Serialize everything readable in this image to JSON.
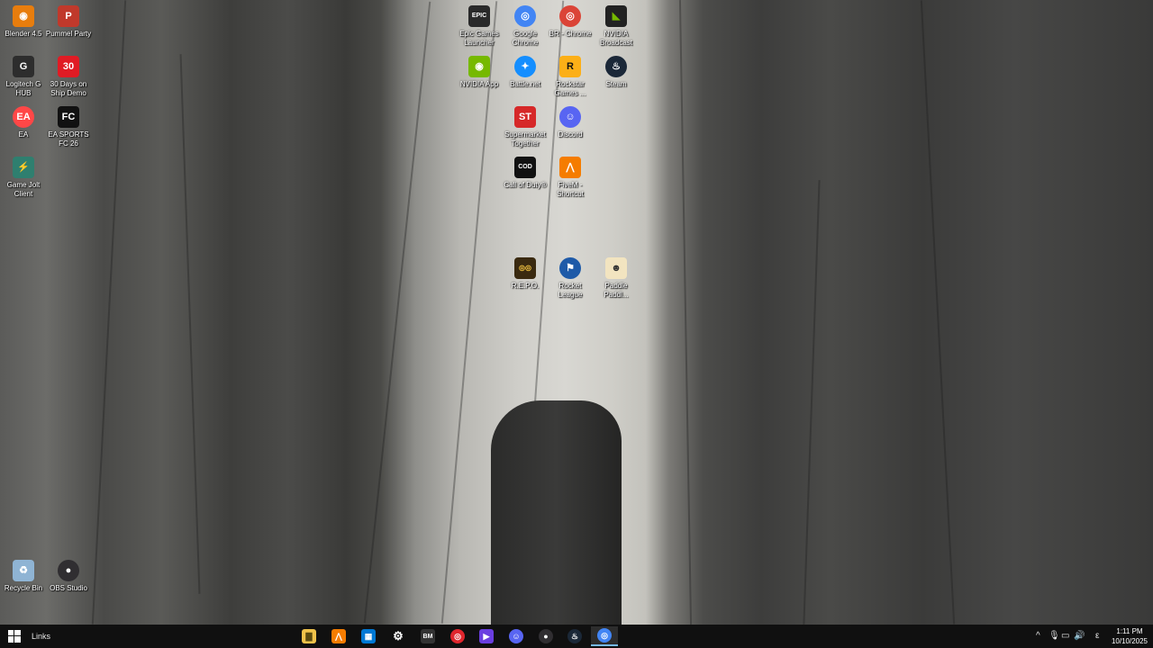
{
  "desktop": {
    "icons": [
      {
        "label": "Blender 4.5",
        "icon": "blender-icon",
        "color": "#e87d0d",
        "glyph": "◉"
      },
      {
        "label": "Pummel Party",
        "icon": "pummel-party-icon",
        "color": "#c0392b",
        "glyph": "P"
      },
      {
        "label": "Logitech G HUB",
        "icon": "logitech-ghub-icon",
        "color": "#2d2d2d",
        "glyph": "G"
      },
      {
        "label": "30 Days on Ship Demo",
        "icon": "30-days-on-ship-icon",
        "color": "#e01b24",
        "glyph": "30"
      },
      {
        "label": "EA",
        "icon": "ea-icon",
        "color": "#ff4747",
        "glyph": "EA"
      },
      {
        "label": "EA SPORTS FC 26",
        "icon": "ea-sports-fc-icon",
        "color": "#111111",
        "glyph": "FC"
      },
      {
        "label": "Game Jolt Client",
        "icon": "game-jolt-icon",
        "color": "#2f7f6f",
        "glyph": "⚡"
      },
      {
        "label": "Epic Games Launcher",
        "icon": "epic-games-icon",
        "color": "#2a2a2a",
        "glyph": "EPIC"
      },
      {
        "label": "Google Chrome",
        "icon": "chrome-icon",
        "color": "#4285f4",
        "glyph": "◎"
      },
      {
        "label": "BR - Chrome",
        "icon": "chrome-profile-icon",
        "color": "#db4437",
        "glyph": "◎"
      },
      {
        "label": "NVIDIA Broadcast",
        "icon": "nvidia-broadcast-icon",
        "color": "#222222",
        "glyph": "◣"
      },
      {
        "label": "NVIDIA App",
        "icon": "nvidia-app-icon",
        "color": "#76b900",
        "glyph": "◉"
      },
      {
        "label": "Battle.net",
        "icon": "battlenet-icon",
        "color": "#148eff",
        "glyph": "✦"
      },
      {
        "label": "Rockstar Games ...",
        "icon": "rockstar-icon",
        "color": "#fcaf17",
        "glyph": "R"
      },
      {
        "label": "Steam",
        "icon": "steam-icon",
        "color": "#1b2838",
        "glyph": "♨"
      },
      {
        "label": "Supermarket Together",
        "icon": "supermarket-together-icon",
        "color": "#d62828",
        "glyph": "ST"
      },
      {
        "label": "Discord",
        "icon": "discord-icon",
        "color": "#5865f2",
        "glyph": "☺"
      },
      {
        "label": "Call of Duty®",
        "icon": "call-of-duty-icon",
        "color": "#111111",
        "glyph": "COD"
      },
      {
        "label": "FiveM - Shortcut",
        "icon": "fivem-icon",
        "color": "#f57c00",
        "glyph": "⋀"
      },
      {
        "label": "R.E.P.O.",
        "icon": "repo-icon",
        "color": "#3a2a10",
        "glyph": "◎◎"
      },
      {
        "label": "Rocket League",
        "icon": "rocket-league-icon",
        "color": "#1e5aa8",
        "glyph": "⚑"
      },
      {
        "label": "Paddle Paddl...",
        "icon": "paddle-icon",
        "color": "#f2e4c0",
        "glyph": "☻"
      },
      {
        "label": "Recycle Bin",
        "icon": "recycle-bin-icon",
        "color": "#8fb4d4",
        "glyph": "♻"
      },
      {
        "label": "OBS Studio",
        "icon": "obs-studio-icon",
        "color": "#302e31",
        "glyph": "●"
      }
    ]
  },
  "taskbar": {
    "links_label": "Links",
    "apps": [
      {
        "name": "file-explorer-icon",
        "color": "#f0c24a",
        "glyph": "▇",
        "active": false
      },
      {
        "name": "fivem-taskbar-icon",
        "color": "#f57c00",
        "glyph": "⋀",
        "active": false
      },
      {
        "name": "microsoft-store-icon",
        "color": "#0078d4",
        "glyph": "▦",
        "active": false
      },
      {
        "name": "gear-settings-icon",
        "color": "#101010",
        "glyph": "⚙",
        "active": false
      },
      {
        "name": "bm-app-icon",
        "color": "#333333",
        "glyph": "BM",
        "active": false
      },
      {
        "name": "red-circle-app-icon",
        "color": "#e0262d",
        "glyph": "◎",
        "active": false
      },
      {
        "name": "purple-play-icon",
        "color": "#6a3ee0",
        "glyph": "▶",
        "active": false
      },
      {
        "name": "discord-taskbar-icon",
        "color": "#5865f2",
        "glyph": "☺",
        "active": false
      },
      {
        "name": "obs-taskbar-icon",
        "color": "#302e31",
        "glyph": "●",
        "active": false
      },
      {
        "name": "steam-taskbar-icon",
        "color": "#1b2838",
        "glyph": "♨",
        "active": false
      },
      {
        "name": "chrome-taskbar-icon",
        "color": "#4285f4",
        "glyph": "◎",
        "active": true
      }
    ],
    "tray": {
      "chevron": "^",
      "language": "ε",
      "time": "1:11 PM",
      "date": "10/10/2025"
    }
  }
}
